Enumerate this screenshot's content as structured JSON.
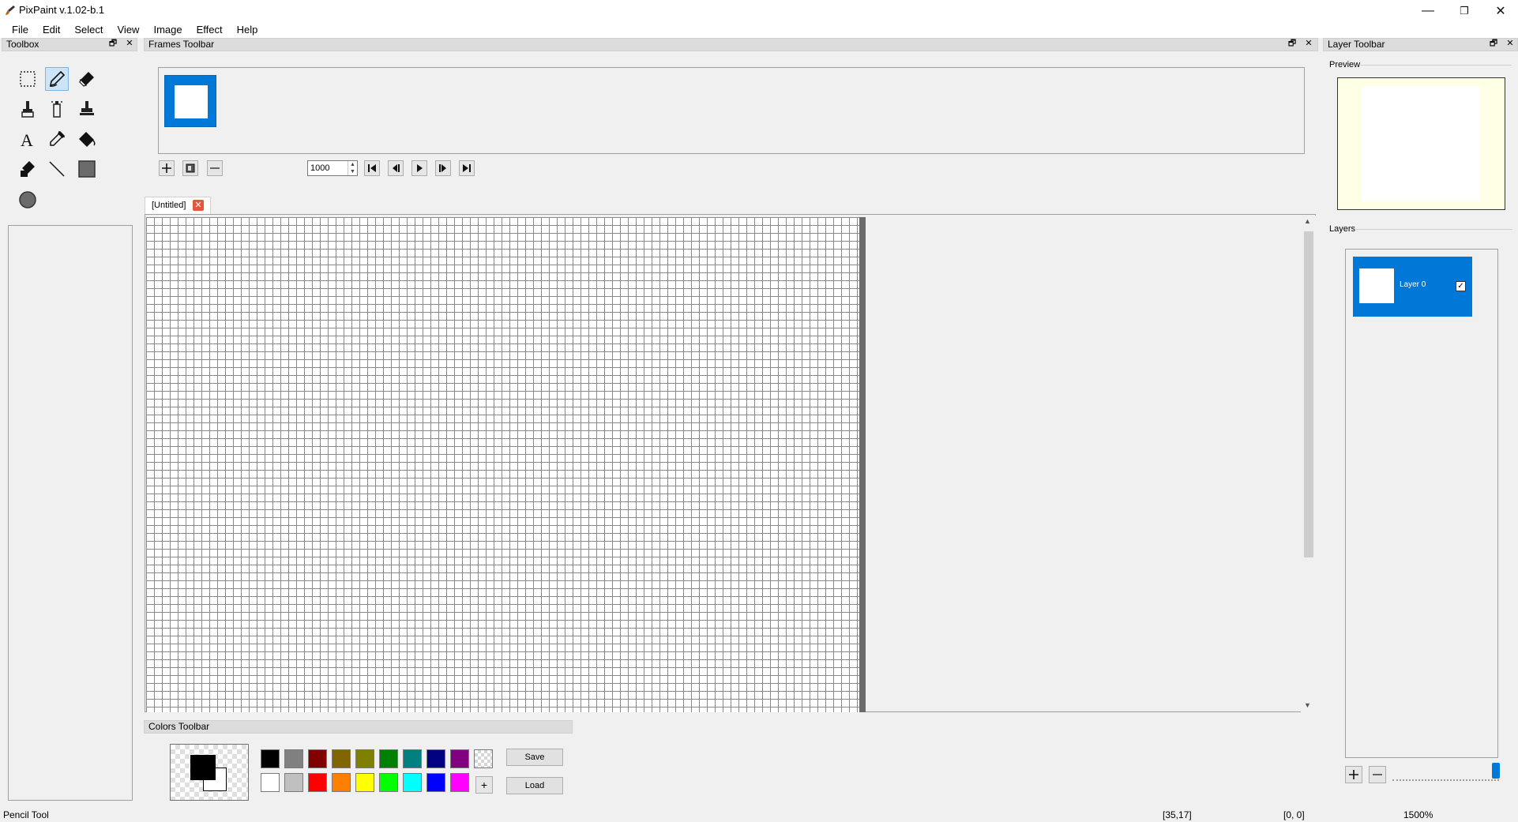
{
  "window": {
    "title": "PixPaint v.1.02-b.1",
    "minimize_glyph": "—",
    "restore_glyph": "❐",
    "close_glyph": "✕"
  },
  "menu": [
    "File",
    "Edit",
    "Select",
    "View",
    "Image",
    "Effect",
    "Help"
  ],
  "panels": {
    "toolbox": "Toolbox",
    "frames": "Frames Toolbar",
    "layers": "Layer Toolbar",
    "colors": "Colors Toolbar",
    "float_glyph": "🗗",
    "close_glyph": "✕"
  },
  "tools": [
    {
      "name": "rectangle-select",
      "icon": "select-rect-icon",
      "selected": false
    },
    {
      "name": "pencil",
      "icon": "pencil-icon",
      "selected": true
    },
    {
      "name": "eraser",
      "icon": "eraser-icon",
      "selected": false
    },
    {
      "name": "brush",
      "icon": "brush-icon",
      "selected": false
    },
    {
      "name": "spray",
      "icon": "spray-icon",
      "selected": false
    },
    {
      "name": "stamp",
      "icon": "stamp-icon",
      "selected": false
    },
    {
      "name": "text",
      "icon": "text-icon",
      "selected": false
    },
    {
      "name": "eyedropper",
      "icon": "eyedropper-icon",
      "selected": false
    },
    {
      "name": "fill",
      "icon": "fill-bucket-icon",
      "selected": false
    },
    {
      "name": "recolor",
      "icon": "recolor-icon",
      "selected": false
    },
    {
      "name": "line",
      "icon": "line-icon",
      "selected": false
    },
    {
      "name": "rectangle",
      "icon": "rectangle-icon",
      "selected": false
    },
    {
      "name": "ellipse",
      "icon": "ellipse-icon",
      "selected": false
    }
  ],
  "frames": {
    "delay": "1000",
    "buttons": [
      "add-frame-icon",
      "duplicate-frame-icon",
      "remove-frame-icon"
    ],
    "nav": [
      "first-frame-icon",
      "previous-frame-icon",
      "play-icon",
      "next-frame-icon",
      "last-frame-icon"
    ]
  },
  "document": {
    "tab_title": "[Untitled]",
    "tab_close": "✕"
  },
  "colors": {
    "foreground": "#000000",
    "background": "#ffffff",
    "palette_row1": [
      "#000000",
      "#808080",
      "#800000",
      "#806600",
      "#808000",
      "#008000",
      "#008080",
      "#000080",
      "#800080",
      "transparent"
    ],
    "palette_row2": [
      "#ffffff",
      "#c0c0c0",
      "#ff0000",
      "#ff8000",
      "#ffff00",
      "#00ff00",
      "#00ffff",
      "#0000ff",
      "#ff00ff"
    ],
    "add_label": "+",
    "save_label": "Save",
    "load_label": "Load"
  },
  "layer_toolbar": {
    "preview_label": "Preview",
    "layers_label": "Layers",
    "layer_name": "Layer 0",
    "layer_visible": "✓",
    "add_glyph": "+",
    "remove_glyph": "—"
  },
  "status": {
    "tool": "Pencil Tool",
    "cursor": "[35,17]",
    "selection": "[0, 0]",
    "zoom": "1500%"
  },
  "accent": "#0078d7"
}
